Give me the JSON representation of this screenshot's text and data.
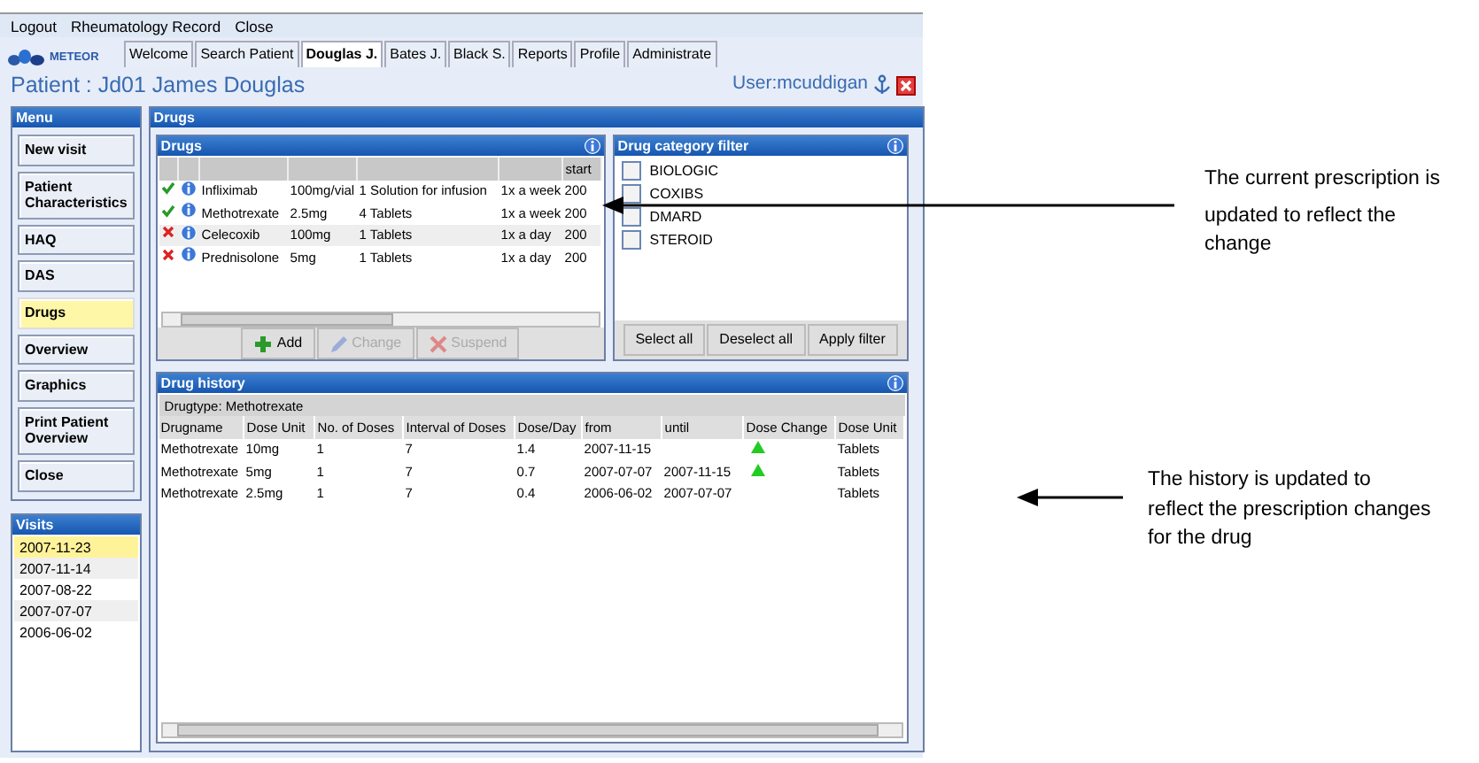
{
  "menu_bar": [
    "Logout",
    "Rheumatology Record",
    "Close"
  ],
  "logo": "METEOR",
  "tabs": [
    {
      "label": "Welcome",
      "selected": false
    },
    {
      "label": "Search Patient",
      "selected": false
    },
    {
      "label": "Douglas J.",
      "selected": true
    },
    {
      "label": "Bates J.",
      "selected": false
    },
    {
      "label": "Black S.",
      "selected": false
    },
    {
      "label": "Reports",
      "selected": false
    },
    {
      "label": "Profile",
      "selected": false
    },
    {
      "label": "Administrate",
      "selected": false
    }
  ],
  "patient_title": "Patient : Jd01 James Douglas",
  "user": "User:mcuddigan",
  "menu": {
    "title": "Menu",
    "items": [
      {
        "label": "New visit",
        "selected": false
      },
      {
        "label": "Patient Characteristics",
        "selected": false
      },
      {
        "label": "HAQ",
        "selected": false
      },
      {
        "label": "DAS",
        "selected": false
      },
      {
        "label": "Drugs",
        "selected": true
      },
      {
        "label": "Overview",
        "selected": false
      },
      {
        "label": "Graphics",
        "selected": false
      },
      {
        "label": "Print Patient Overview",
        "selected": false
      },
      {
        "label": "Close",
        "selected": false
      }
    ]
  },
  "visits": {
    "title": "Visits",
    "items": [
      {
        "label": "2007-11-23",
        "selected": true
      },
      {
        "label": "2007-11-14",
        "selected": false
      },
      {
        "label": "2007-08-22",
        "selected": false
      },
      {
        "label": "2007-07-07",
        "selected": false
      },
      {
        "label": "2006-06-02",
        "selected": false
      }
    ]
  },
  "main_title": "Drugs",
  "drugs": {
    "title": "Drugs",
    "start_header": "start",
    "rows": [
      {
        "active": true,
        "name": "Infliximab",
        "dose": "100mg/vial",
        "amount": "1 Solution for infusion",
        "frequency": "1x a week",
        "start": "200"
      },
      {
        "active": true,
        "name": "Methotrexate",
        "dose": "2.5mg",
        "amount": "4 Tablets",
        "frequency": "1x a week",
        "start": "200"
      },
      {
        "active": false,
        "name": "Celecoxib",
        "dose": "100mg",
        "amount": "1 Tablets",
        "frequency": "1x a day",
        "start": "200"
      },
      {
        "active": false,
        "name": "Prednisolone",
        "dose": "5mg",
        "amount": "1 Tablets",
        "frequency": "1x a day",
        "start": "200"
      }
    ],
    "buttons": [
      {
        "kind": "add",
        "label": "Add",
        "disabled": false
      },
      {
        "kind": "change",
        "label": "Change",
        "disabled": true
      },
      {
        "kind": "suspend",
        "label": "Suspend",
        "disabled": true
      }
    ]
  },
  "filter": {
    "title": "Drug category filter",
    "items": [
      {
        "label": "BIOLOGIC",
        "checked": false
      },
      {
        "label": "COXIBS",
        "checked": false
      },
      {
        "label": "DMARD",
        "checked": false
      },
      {
        "label": "STEROID",
        "checked": false
      }
    ],
    "buttons": [
      "Select all",
      "Deselect all",
      "Apply filter"
    ]
  },
  "history": {
    "title": "Drug history",
    "group": "Drugtype: Methotrexate",
    "columns": [
      "Drugname",
      "Dose Unit",
      "No. of Doses",
      "Interval of Doses",
      "Dose/Day",
      "from",
      "until",
      "Dose Change",
      "Dose Unit"
    ],
    "rows": [
      {
        "cells": [
          "Methotrexate",
          "10mg",
          "1",
          "7",
          "1.4",
          "2007-11-15",
          "",
          "",
          "Tablets"
        ],
        "dose_increase": true
      },
      {
        "cells": [
          "Methotrexate",
          "5mg",
          "1",
          "7",
          "0.7",
          "2007-07-07",
          "2007-11-15",
          "",
          "Tablets"
        ],
        "dose_increase": true
      },
      {
        "cells": [
          "Methotrexate",
          "2.5mg",
          "1",
          "7",
          "0.4",
          "2006-06-02",
          "2007-07-07",
          "",
          "Tablets"
        ],
        "dose_increase": false
      }
    ]
  },
  "annotations": [
    {
      "paragraphs": [
        "The current prescription is",
        "updated to reflect the change"
      ]
    },
    {
      "paragraphs": [
        "The history is updated to reflect the prescription changes for the drug"
      ]
    }
  ]
}
